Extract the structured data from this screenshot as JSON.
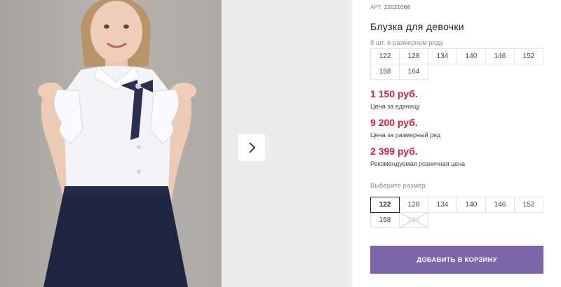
{
  "product": {
    "article_label": "АРТ.",
    "article_number": "22021068",
    "title": "Блузка для девочки",
    "row_info": "8 шт. в размерном ряду",
    "row_sizes": [
      "122",
      "128",
      "134",
      "140",
      "146",
      "152",
      "158",
      "164"
    ],
    "prices": [
      {
        "value": "1 150 руб.",
        "note": "Цена за единицу"
      },
      {
        "value": "9 200 руб.",
        "note": "Цена за размерный ряд"
      },
      {
        "value": "2 399 руб.",
        "note": "Рекомендуемая розничная цена"
      }
    ],
    "choose_label": "Выберите размер:",
    "size_options": [
      {
        "label": "122",
        "state": "selected"
      },
      {
        "label": "128",
        "state": "available"
      },
      {
        "label": "134",
        "state": "available"
      },
      {
        "label": "140",
        "state": "available"
      },
      {
        "label": "146",
        "state": "available"
      },
      {
        "label": "152",
        "state": "available"
      },
      {
        "label": "158",
        "state": "available"
      },
      {
        "label": "164",
        "state": "unavailable"
      }
    ],
    "add_to_cart": "ДОБАВИТЬ В КОРЗИНУ"
  },
  "gallery": {
    "next_icon": "chevron-right-icon"
  },
  "colors": {
    "price": "#d8203b",
    "button": "#7c65a8",
    "photo_bg": "#aeaaa6",
    "skirt": "#1d2541",
    "bow": "#2a3150"
  }
}
